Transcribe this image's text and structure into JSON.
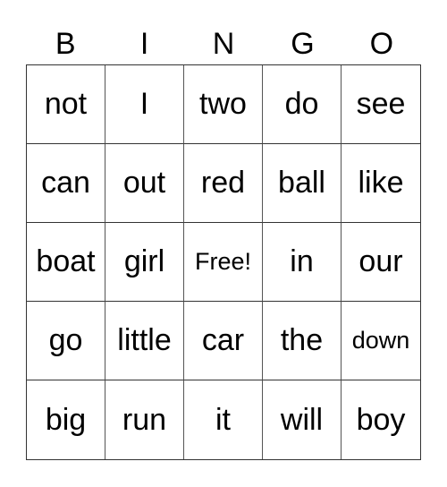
{
  "header": [
    "B",
    "I",
    "N",
    "G",
    "O"
  ],
  "rows": [
    [
      "not",
      "I",
      "two",
      "do",
      "see"
    ],
    [
      "can",
      "out",
      "red",
      "ball",
      "like"
    ],
    [
      "boat",
      "girl",
      "Free!",
      "in",
      "our"
    ],
    [
      "go",
      "little",
      "car",
      "the",
      "down"
    ],
    [
      "big",
      "run",
      "it",
      "will",
      "boy"
    ]
  ]
}
